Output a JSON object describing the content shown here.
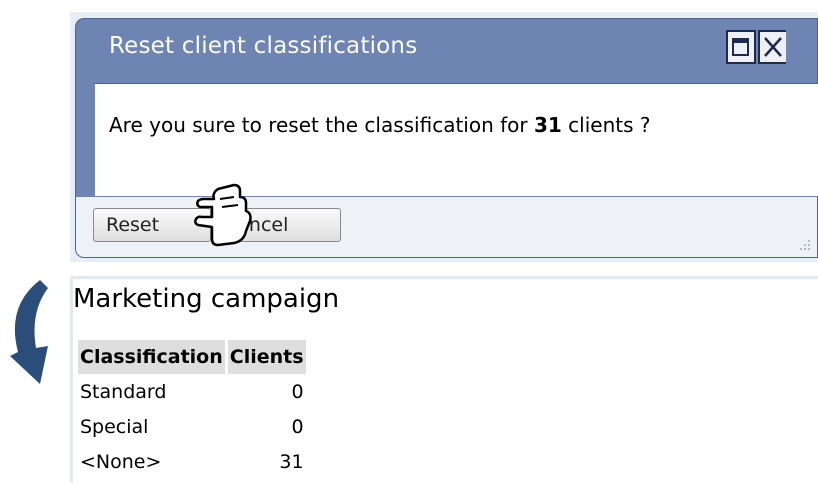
{
  "dialog": {
    "title": "Reset client classifications",
    "message_prefix": "Are you sure to reset the classification for ",
    "message_count": "31",
    "message_suffix": " clients ?",
    "reset_label": "Reset",
    "cancel_label": "Cancel",
    "maximize_icon": "maximize-icon",
    "close_icon": "close-icon"
  },
  "report": {
    "title": "Marketing campaign",
    "columns": [
      "Classification",
      "Clients"
    ],
    "rows": [
      {
        "classification": "Standard",
        "clients": "0"
      },
      {
        "classification": "Special",
        "clients": "0"
      },
      {
        "classification": "<None>",
        "clients": "31"
      }
    ]
  },
  "colors": {
    "titlebar": "#6e85b4",
    "header_bg": "#dedede",
    "arrow": "#2a4d7a"
  }
}
